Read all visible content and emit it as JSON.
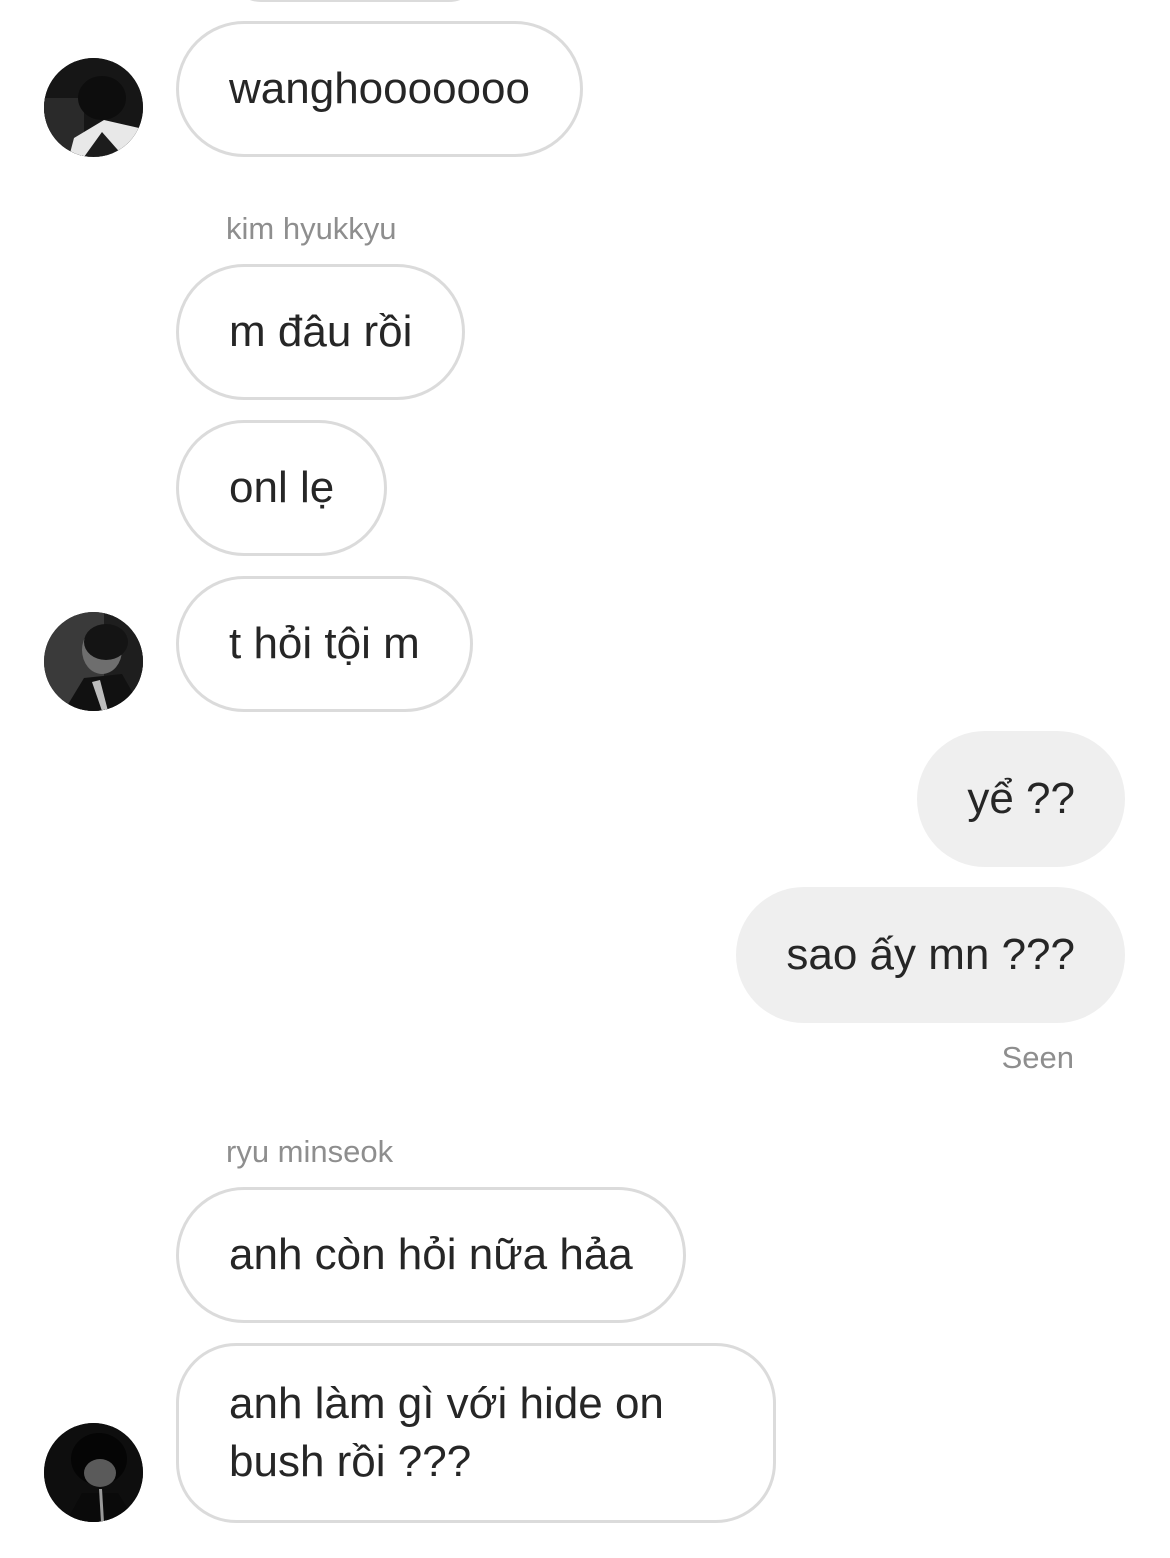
{
  "conversation": {
    "messages": [
      {
        "text": "wanghooooooo"
      },
      {
        "text": "m đâu rồi"
      },
      {
        "text": "onl lẹ"
      },
      {
        "text": "t hỏi tội m"
      },
      {
        "text": "yể ??"
      },
      {
        "text": "sao ấy mn ???"
      },
      {
        "text": "anh còn hỏi nữa hảa"
      },
      {
        "text": "anh làm gì với hide on bush rồi ???"
      }
    ],
    "senders": {
      "kim": "kim hyukkyu",
      "ryu": "ryu minseok"
    },
    "seen_label": "Seen"
  }
}
